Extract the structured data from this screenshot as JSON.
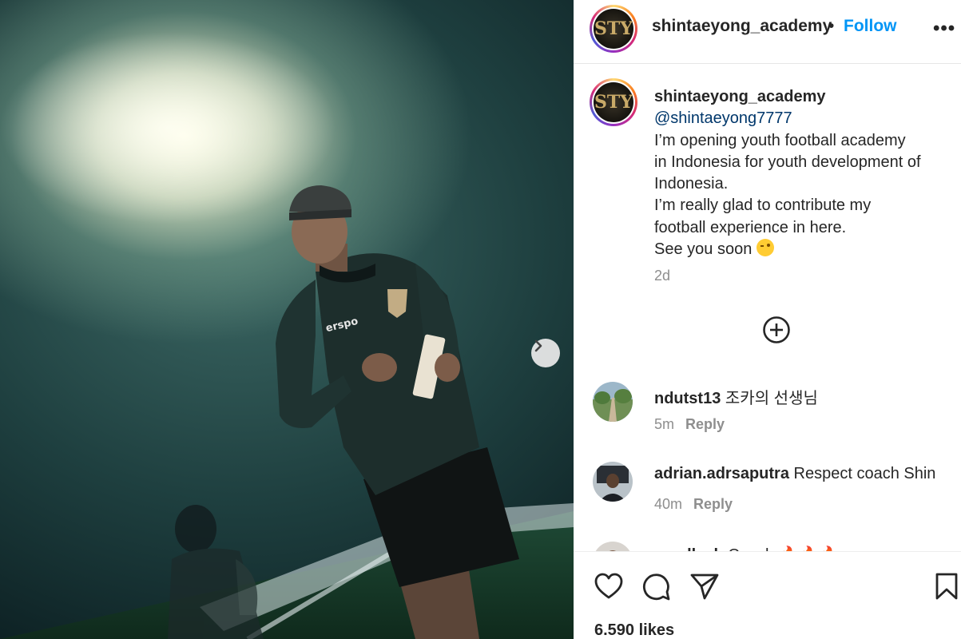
{
  "post": {
    "username": "shintaeyong_academy",
    "separator": "•",
    "follow_label": "Follow",
    "more_label": "•••",
    "logo_mark": "STY"
  },
  "caption": {
    "username": "shintaeyong_academy",
    "mention": "@shintaeyong7777",
    "line1": "I’m opening youth football academy",
    "line2": "in Indonesia for youth development of",
    "line3": "Indonesia.",
    "line4": "I’m really glad to contribute my",
    "line5": "football experience in here.",
    "line6": "See you soon",
    "time": "2d"
  },
  "media": {
    "jacket_brand": "erspo"
  },
  "comments": [
    {
      "user": "ndutst13",
      "text": "조카의 선생님",
      "time": "5m",
      "reply": "Reply"
    },
    {
      "user": "adrian.adrsaputra",
      "text": "Respect coach Shin",
      "time": "40m",
      "reply": "Reply"
    },
    {
      "user": "msollaah",
      "text": "Coach",
      "time": "",
      "reply": ""
    }
  ],
  "likes": "6.590 likes",
  "icons": {
    "next": "chevron-right-icon",
    "load_more": "plus-circle-icon",
    "like": "heart-icon",
    "comment": "comment-bubble-icon",
    "share": "paper-plane-icon",
    "save": "bookmark-icon",
    "wink": "winking-face-emoji",
    "fire": "fire-emoji"
  },
  "colors": {
    "accent": "#0095f6",
    "mention": "#00376b",
    "muted": "#8e8e8e",
    "text": "#262626"
  }
}
